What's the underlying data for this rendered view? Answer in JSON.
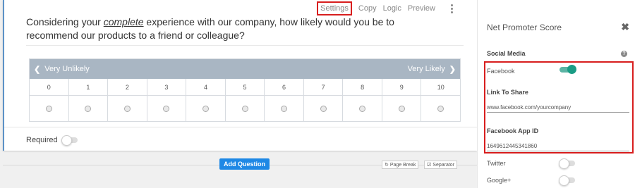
{
  "toolbar": {
    "settings": "Settings",
    "copy": "Copy",
    "logic": "Logic",
    "preview": "Preview",
    "more_icon": "kebab-menu-icon"
  },
  "question": {
    "text_before": "Considering your ",
    "text_emphasis": "complete",
    "text_after": " experience with our company, how likely would you be to recommend our products to a friend or colleague?"
  },
  "nps": {
    "left_label": "Very Unlikely",
    "right_label": "Very Likely",
    "left_icon": "chevron-left-icon",
    "right_icon": "chevron-right-icon",
    "scale": [
      "0",
      "1",
      "2",
      "3",
      "4",
      "5",
      "6",
      "7",
      "8",
      "9",
      "10"
    ],
    "header_color": "#a9b6c3"
  },
  "required": {
    "label": "Required",
    "enabled": false
  },
  "actions": {
    "add_question": "Add Question",
    "page_break": "Page Break",
    "separator": "Separator",
    "accent_color": "#1e88e5"
  },
  "panel": {
    "title": "Net Promoter Score",
    "close_icon": "close-icon",
    "section": "Social Media",
    "help_icon": "help-icon",
    "facebook_label": "Facebook",
    "facebook_enabled": true,
    "link_label": "Link To Share",
    "link_value": "www.facebook.com/yourcompany",
    "app_id_label": "Facebook App ID",
    "app_id_value": "1649612445341860",
    "twitter_label": "Twitter",
    "twitter_enabled": false,
    "google_label": "Google+",
    "google_enabled": false,
    "highlight_color": "#d81e1e",
    "toggle_on_color": "#1a9c85"
  }
}
